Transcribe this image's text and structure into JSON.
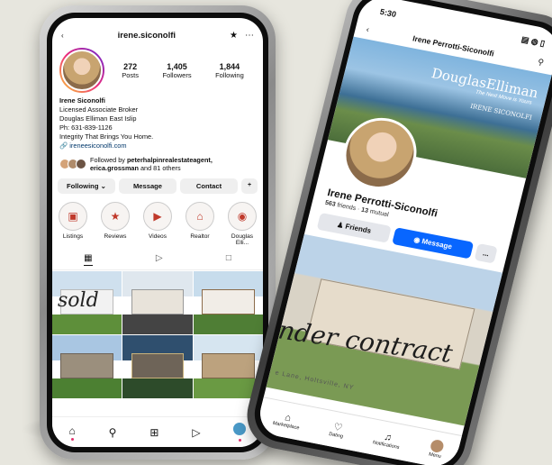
{
  "instagram": {
    "username": "irene.siconolfi",
    "stats": [
      {
        "number": "272",
        "label": "Posts"
      },
      {
        "number": "1,405",
        "label": "Followers"
      },
      {
        "number": "1,844",
        "label": "Following"
      }
    ],
    "bio": {
      "name": "Irene Siconolfi",
      "line1": "Licensed Associate Broker",
      "line2": "Douglas Elliman East Islip",
      "phone": "Ph: 631-839-1126",
      "tagline": "Integrity That Brings You Home.",
      "link": "ireneesiconolfi.com"
    },
    "followed_by": {
      "prefix": "Followed by ",
      "names": "peterhalpinrealestateagent,",
      "names2": "erica.grossman",
      "suffix": " and 81 others"
    },
    "buttons": {
      "following": "Following",
      "message": "Message",
      "contact": "Contact",
      "add_user": "+"
    },
    "highlights": [
      "Listings",
      "Reviews",
      "Videos",
      "Realtor",
      "Douglas Elli..."
    ],
    "grid": [
      {
        "overlay": "sold",
        "caption": ""
      },
      {
        "overlay": "",
        "caption": ""
      },
      {
        "overlay": "",
        "caption": ""
      },
      {
        "overlay": "",
        "caption": ""
      },
      {
        "overlay": "",
        "caption": ""
      },
      {
        "overlay": "",
        "caption": ""
      }
    ]
  },
  "facebook": {
    "time": "5:30",
    "page_title": "Irene Perrotti-Siconolfi",
    "cover": {
      "brand": "DouglasElliman",
      "tagline": "The Next Move is Yours",
      "brand2": "IRENE SICONOLFI"
    },
    "profile_name": "Irene Perrotti-Siconolfi",
    "friends_count": "563",
    "friends_label": "friends",
    "mutual_count": "13",
    "mutual_label": "mutual",
    "buttons": {
      "friends": "Friends",
      "message": "Message",
      "more": "..."
    },
    "photo_script": "nder contract",
    "photo_address": "e Lane, Holtsville, NY",
    "nav": [
      "Marketplace",
      "Dating",
      "Notifications",
      "Menu"
    ]
  },
  "colors": {
    "ig_gradient_start": "#f9ce34",
    "ig_gradient_end": "#6228d7",
    "fb_blue": "#0866ff",
    "background": "#e7e6de"
  }
}
